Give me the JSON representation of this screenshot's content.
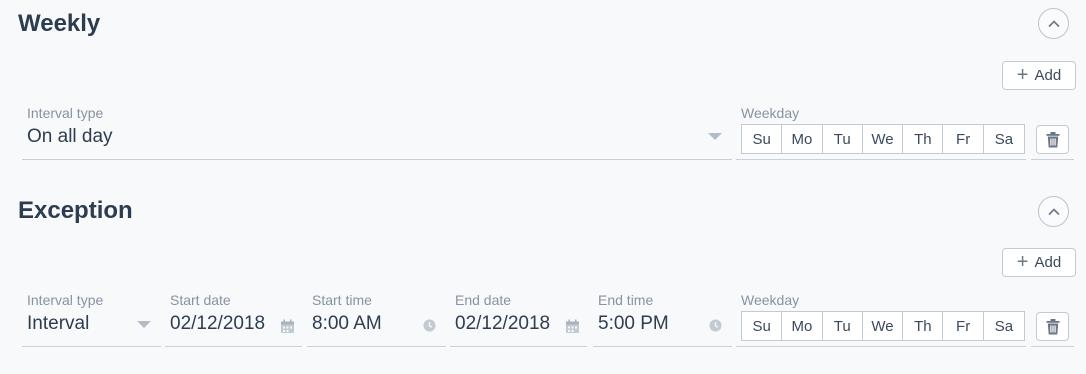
{
  "weekly": {
    "title": "Weekly",
    "add_label": "Add",
    "interval_type_label": "Interval type",
    "interval_type_value": "On all day",
    "weekday_label": "Weekday",
    "days": [
      "Su",
      "Mo",
      "Tu",
      "We",
      "Th",
      "Fr",
      "Sa"
    ]
  },
  "exception": {
    "title": "Exception",
    "add_label": "Add",
    "interval_type_label": "Interval type",
    "interval_type_value": "Interval",
    "start_date_label": "Start date",
    "start_date_value": "02/12/2018",
    "start_time_label": "Start time",
    "start_time_value": "8:00 AM",
    "end_date_label": "End date",
    "end_date_value": "02/12/2018",
    "end_time_label": "End time",
    "end_time_value": "5:00 PM",
    "weekday_label": "Weekday",
    "days": [
      "Su",
      "Mo",
      "Tu",
      "We",
      "Th",
      "Fr",
      "Sa"
    ]
  },
  "icons": {
    "collapse": "chevron-up-icon",
    "add": "plus-icon",
    "delete": "trash-icon",
    "date": "calendar-icon",
    "time": "clock-icon",
    "dropdown": "caret-down-icon"
  }
}
